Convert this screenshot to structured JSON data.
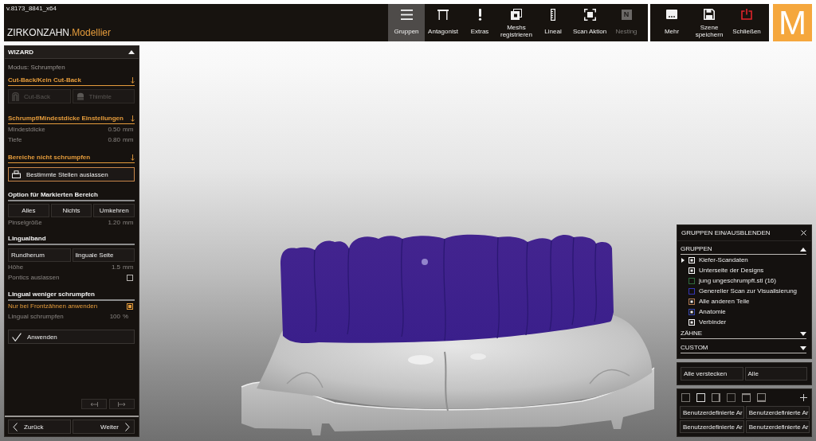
{
  "header": {
    "version": "v.8173_8841_x64",
    "brand": "ZIRKONZAHN",
    "product": ".Modellier"
  },
  "toolbar": {
    "tools": [
      {
        "label": "Gruppen",
        "selected": true,
        "disabled": false
      },
      {
        "label": "Antagonist",
        "selected": false,
        "disabled": false
      },
      {
        "label": "Extras",
        "selected": false,
        "disabled": false
      },
      {
        "label": "Meshs\nregistrieren",
        "selected": false,
        "disabled": false
      },
      {
        "label": "Lineal",
        "selected": false,
        "disabled": false
      },
      {
        "label": "Scan Aktion",
        "selected": false,
        "disabled": false
      },
      {
        "label": "Nesting",
        "glyph": "N",
        "selected": false,
        "disabled": true
      }
    ],
    "actions": [
      {
        "label": "Mehr"
      },
      {
        "label": "Szene\nspeichern"
      },
      {
        "label": "Schließen"
      }
    ]
  },
  "menu_tile": {
    "letter": "M"
  },
  "wizard": {
    "title": "WIZARD",
    "expanded": true,
    "mode": "Modus: Schrumpfen",
    "sections": [
      {
        "title": "Cut-Back/Kein Cut-Back",
        "highlighted": true,
        "rows": [
          {
            "kind": "icon-buttons",
            "buttons": [
              {
                "label": "Cut-Back",
                "disabled": true
              },
              {
                "label": "Thimble",
                "disabled": true
              }
            ]
          }
        ]
      },
      {
        "title": "Schrumpf/Mindestdicke Einstellungen",
        "highlighted": true,
        "rows": [
          {
            "kind": "value",
            "label": "Mindestdicke",
            "value": "0.50",
            "unit": "mm"
          },
          {
            "kind": "value",
            "label": "Tiefe",
            "value": "0.80",
            "unit": "mm"
          }
        ]
      },
      {
        "title": "Bereiche nicht schrumpfen",
        "highlighted": true,
        "rows": [
          {
            "kind": "tool",
            "label": "Bestimmte Stellen auslassen",
            "active": true
          }
        ]
      },
      {
        "title": "Option für Markierten Bereich",
        "highlighted": false,
        "rows": [
          {
            "kind": "buttons",
            "buttons": [
              {
                "label": "Alles"
              },
              {
                "label": "Nichts"
              },
              {
                "label": "Umkehren"
              }
            ]
          },
          {
            "kind": "value",
            "label": "Pinselgröße",
            "value": "1.20",
            "unit": "mm"
          }
        ]
      },
      {
        "title": "Lingualband",
        "highlighted": false,
        "rows": [
          {
            "kind": "options",
            "buttons": [
              {
                "label": "Rundherum"
              },
              {
                "label": "linguale Seite"
              }
            ]
          },
          {
            "kind": "value",
            "label": "Höhe",
            "value": "1.5",
            "unit": "mm"
          },
          {
            "kind": "checkbox",
            "label": "Pontics auslassen",
            "checked": false
          }
        ]
      },
      {
        "title": "Lingual weniger schrumpfen",
        "highlighted": false,
        "rows": [
          {
            "kind": "checkbox",
            "label": "Nur bei Frontzähnen anwenden",
            "checked": true
          },
          {
            "kind": "value",
            "label": "Lingual schrumpfen",
            "value": "100",
            "unit": "%"
          },
          {
            "kind": "apply",
            "label": "Anwenden",
            "active": false
          }
        ]
      }
    ],
    "nav": [
      {
        "label": "Zurück"
      },
      {
        "label": "Weiter"
      }
    ]
  },
  "groups_panel": {
    "title": "GRUPPEN EIN/AUSBLENDEN",
    "sections": [
      {
        "title": "GRUPPEN",
        "expanded": true,
        "items": [
          {
            "label": "Kiefer-Scandaten",
            "kind": "group",
            "checked": true,
            "color": "#ffffff"
          },
          {
            "label": "Unterseite der Designs",
            "kind": "layer",
            "checked": true,
            "color": "#ffffff"
          },
          {
            "label": "jung ungeschrumpft.stl (16)",
            "kind": "layer",
            "checked": false,
            "color": "#2f6b3c"
          },
          {
            "label": "Genereller Scan zur Visualisierung",
            "kind": "layer",
            "checked": false,
            "color": "#3535b5"
          },
          {
            "label": "Alle anderen Teile",
            "kind": "layer",
            "checked": true,
            "color": "#b07a52"
          },
          {
            "label": "Anatomie",
            "kind": "layer",
            "checked": true,
            "color": "#3848b0"
          },
          {
            "label": "Verbinder",
            "kind": "layer",
            "checked": true,
            "color": "#ffffff"
          }
        ]
      },
      {
        "title": "ZÄHNE",
        "expanded": false
      },
      {
        "title": "CUSTOM",
        "expanded": false
      }
    ]
  },
  "visibility_buttons": [
    {
      "label": "Alle verstecken"
    },
    {
      "label": "Alle"
    }
  ],
  "custom_views": [
    {
      "label": "Benutzerdefinierte Ar"
    },
    {
      "label": "Benutzerdefinierte Ar"
    },
    {
      "label": "Benutzerdefinierte Ar"
    },
    {
      "label": "Benutzerdefinierte Ar"
    }
  ]
}
